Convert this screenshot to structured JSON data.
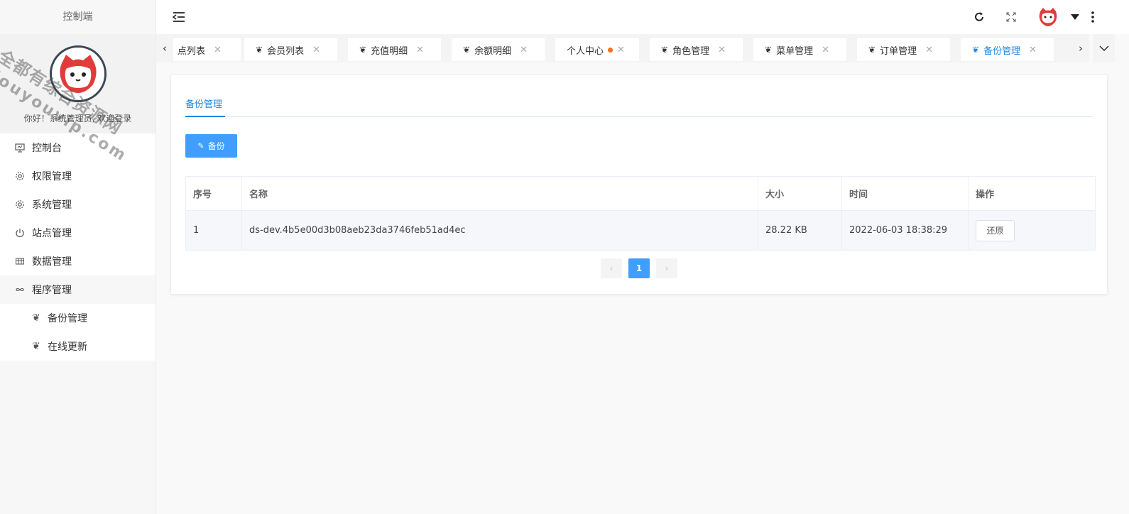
{
  "sidebar": {
    "title": "控制端",
    "greeting": "你好！系统管理员, 欢迎登录",
    "watermark_line1": "全都有综合资源网",
    "watermark_line2": "douyouvip.com",
    "menu": [
      {
        "label": "控制台",
        "icon": "monitor-icon"
      },
      {
        "label": "权限管理",
        "icon": "gear-icon"
      },
      {
        "label": "系统管理",
        "icon": "gear-icon"
      },
      {
        "label": "站点管理",
        "icon": "power-icon"
      },
      {
        "label": "数据管理",
        "icon": "table-icon"
      },
      {
        "label": "程序管理",
        "icon": "infinity-icon"
      }
    ],
    "submenu": [
      {
        "label": "备份管理",
        "icon": "leaf-icon"
      },
      {
        "label": "在线更新",
        "icon": "leaf-icon"
      }
    ]
  },
  "header": {
    "collapse_icon": "menu-fold-icon",
    "refresh_icon": "refresh-icon",
    "fullscreen_icon": "fullscreen-icon",
    "more_icon": "more-vertical-icon"
  },
  "tabs": [
    {
      "label": "点列表"
    },
    {
      "label": "会员列表"
    },
    {
      "label": "充值明细"
    },
    {
      "label": "余额明细"
    },
    {
      "label": "个人中心"
    },
    {
      "label": "角色管理"
    },
    {
      "label": "菜单管理"
    },
    {
      "label": "订单管理"
    },
    {
      "label": "备份管理",
      "active": true
    }
  ],
  "content": {
    "tab_label": "备份管理",
    "backup_button": "备份",
    "table": {
      "headers": [
        "序号",
        "名称",
        "大小",
        "时间",
        "操作"
      ],
      "rows": [
        {
          "index": "1",
          "name": "ds-dev.4b5e00d3b08aeb23da3746feb51ad4ec",
          "size": "28.22 KB",
          "time": "2022-06-03 18:38:29",
          "action": "还原"
        }
      ]
    },
    "pagination": {
      "current": "1",
      "prev": "‹",
      "next": "›"
    }
  },
  "colors": {
    "accent": "#409eff",
    "tab_active": "#1e88e5",
    "dot": "#f2711c"
  }
}
